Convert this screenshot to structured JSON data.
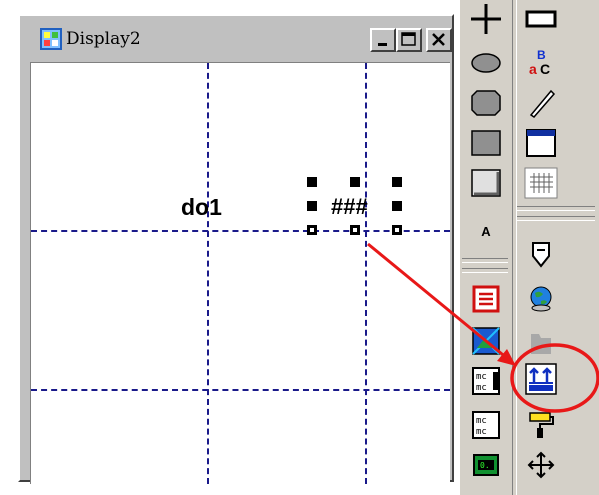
{
  "window": {
    "title": "Display2",
    "buttons": {
      "minimize": "_",
      "maximize": "□",
      "close": "×"
    }
  },
  "canvas": {
    "tag_name": "do1",
    "tag_value": "###"
  },
  "toolbox": {
    "left_column": [
      "crosshair-tool",
      "ellipse-tool",
      "filled-ellipse-tool",
      "rectangle-tool",
      "3d-frame-tool",
      "text-tool",
      "list-tool",
      "picture-tool",
      "multi-state-tool",
      "multi-state-tool-2",
      "numeric-display-tool"
    ],
    "right_column": [
      "rectangle-outline-tool",
      "abc-text-tool",
      "line-tool",
      "window-frame-tool",
      "grid-tool",
      "tag-tool",
      "web-link-tool",
      "disabled-tool",
      "bar-data-tool",
      "paint-roller-tool",
      "move-tool"
    ],
    "text_tool_label": "A",
    "abc_label_top": "B",
    "abc_label_bottom": "C",
    "abc_label_a": "a"
  },
  "annotation": {
    "arrow_color": "#e81818",
    "circle_color": "#e81818"
  }
}
